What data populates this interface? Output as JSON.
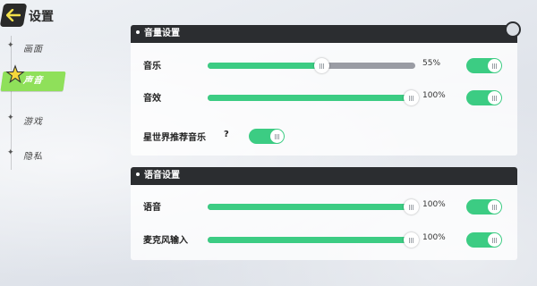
{
  "header": {
    "title": "设置",
    "back_icon": "back-arrow-icon"
  },
  "nav": {
    "items": [
      {
        "label": "画面"
      },
      {
        "label": "声音",
        "active": true
      },
      {
        "label": "游戏"
      },
      {
        "label": "隐私"
      }
    ]
  },
  "volume_section": {
    "title": "音量设置",
    "music": {
      "label": "音乐",
      "value_text": "55%",
      "value": 0.55,
      "enabled": true
    },
    "sfx": {
      "label": "音效",
      "value_text": "100%",
      "value": 1.0,
      "enabled": true
    },
    "recommend": {
      "label": "星世界推荐音乐",
      "help": "?",
      "enabled": true
    }
  },
  "voice_section": {
    "title": "语音设置",
    "voice": {
      "label": "语音",
      "value_text": "100%",
      "value": 1.0,
      "enabled": true
    },
    "mic": {
      "label": "麦克风输入",
      "value_text": "100%",
      "value": 1.0,
      "enabled": true
    }
  },
  "colors": {
    "accent": "#3ccc83",
    "nav_active": "#8fe05a",
    "header": "#2b2d30"
  }
}
